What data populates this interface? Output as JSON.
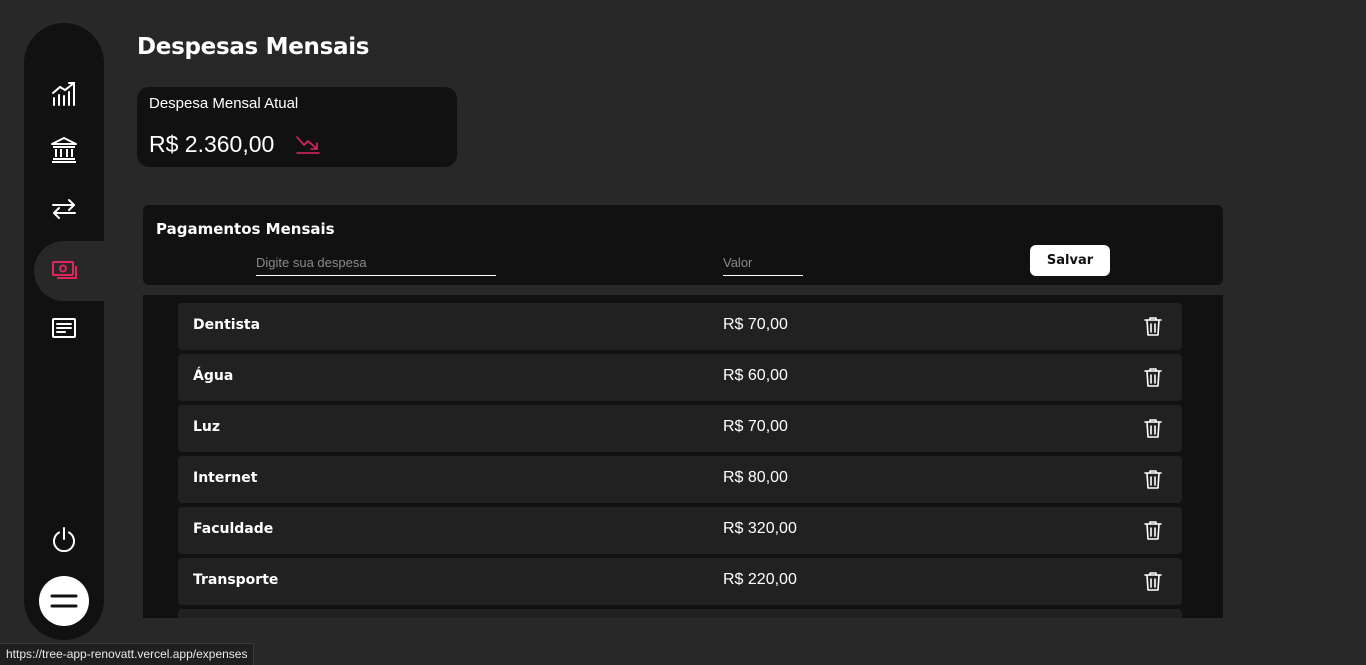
{
  "header": {
    "title": "Despesas Mensais"
  },
  "summary": {
    "label": "Despesa Mensal Atual",
    "value": "R$ 2.360,00",
    "trend_icon": "trending-down-icon",
    "trend_color": "#e0245e"
  },
  "sidebar": {
    "items": [
      {
        "icon": "chart-icon",
        "active": false
      },
      {
        "icon": "bank-icon",
        "active": false
      },
      {
        "icon": "transfer-icon",
        "active": false
      },
      {
        "icon": "money-icon",
        "active": true
      },
      {
        "icon": "notes-icon",
        "active": false
      }
    ],
    "logout_icon": "power-icon",
    "menu_icon": "menu-icon",
    "accent": "#e0245e"
  },
  "form": {
    "title": "Pagamentos Mensais",
    "expense_placeholder": "Digite sua despesa",
    "value_placeholder": "Valor",
    "save_label": "Salvar"
  },
  "expenses": [
    {
      "name": "Dentista",
      "value": "R$ 70,00"
    },
    {
      "name": "Água",
      "value": "R$ 60,00"
    },
    {
      "name": "Luz",
      "value": "R$ 70,00"
    },
    {
      "name": "Internet",
      "value": "R$ 80,00"
    },
    {
      "name": "Faculdade",
      "value": "R$ 320,00"
    },
    {
      "name": "Transporte",
      "value": "R$ 220,00"
    }
  ],
  "status_bar": {
    "url": "https://tree-app-renovatt.vercel.app/expenses"
  }
}
